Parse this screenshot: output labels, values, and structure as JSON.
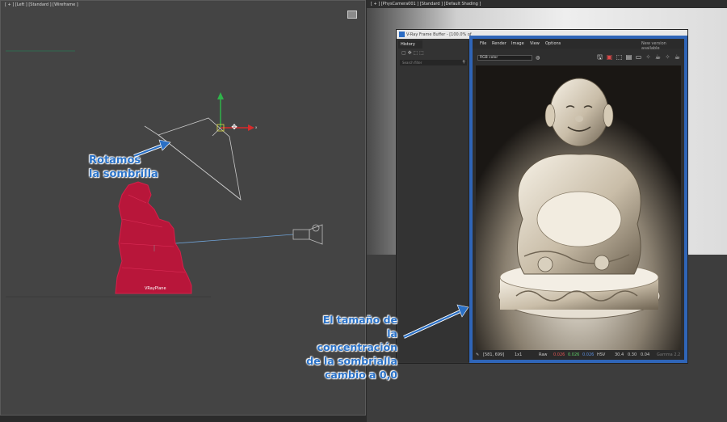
{
  "left_viewport": {
    "label": "[ + ] [Left ] [Standard ] [Wireframe ]",
    "object_label": "VRayPlane"
  },
  "right_viewport": {
    "label": "[ + ] [PhysCamera001 ] [Standard ] [Default Shading ]"
  },
  "annotations": {
    "rotate": [
      "Rotamos",
      "la sombrilla"
    ],
    "size": [
      "El tamaño de",
      "la concentración",
      "de la sombrialla",
      "cambio a 0,0"
    ]
  },
  "frame_buffer": {
    "title": "V-Ray Frame Buffer - [100.0% of",
    "history_tab": "History",
    "search_placeholder": "Search filter",
    "menu": [
      "File",
      "Render",
      "Image",
      "View",
      "Options"
    ],
    "update_notice": "New version available",
    "channel": "RGB color",
    "status": {
      "coords": "[581, 699]",
      "mode": "1x1",
      "raw_label": "Raw",
      "r": "0.026",
      "g": "0.026",
      "b": "0.026",
      "color_mode": "HSV",
      "h": "30.4",
      "s": "0.30",
      "v": "0.04",
      "gamma": "Gamma 2.2"
    }
  },
  "colors": {
    "highlight_border": "#2f65b8",
    "callout_text": "#2a72c8",
    "statue_wireframe": "#c8143c"
  }
}
